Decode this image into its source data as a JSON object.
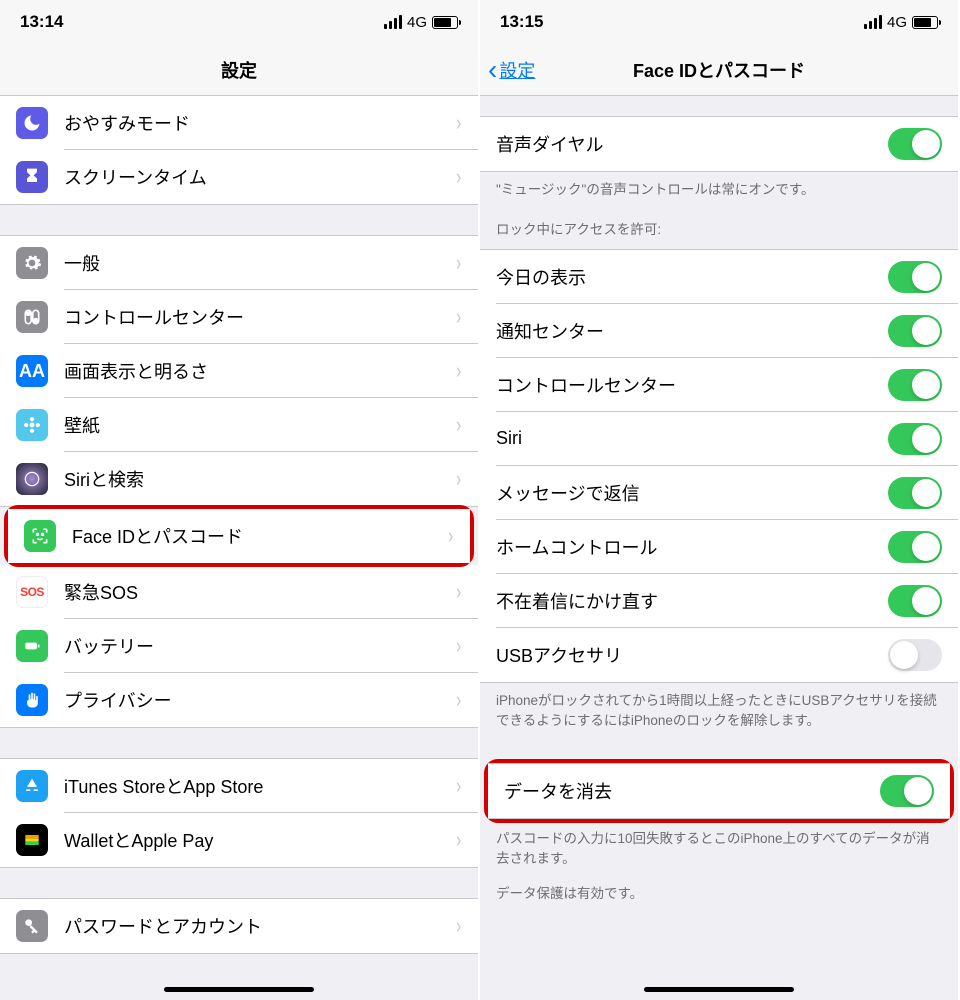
{
  "left": {
    "status": {
      "time": "13:14",
      "net": "4G"
    },
    "nav": {
      "title": "設定"
    },
    "g1": [
      {
        "label": "おやすみモード"
      },
      {
        "label": "スクリーンタイム"
      }
    ],
    "g2": [
      {
        "label": "一般"
      },
      {
        "label": "コントロールセンター"
      },
      {
        "label": "画面表示と明るさ"
      },
      {
        "label": "壁紙"
      },
      {
        "label": "Siriと検索"
      },
      {
        "label": "Face IDとパスコード"
      },
      {
        "label": "緊急SOS"
      },
      {
        "label": "バッテリー"
      },
      {
        "label": "プライバシー"
      }
    ],
    "g3": [
      {
        "label": "iTunes StoreとApp Store"
      },
      {
        "label": "WalletとApple Pay"
      }
    ],
    "g4": [
      {
        "label": "パスワードとアカウント"
      }
    ]
  },
  "right": {
    "status": {
      "time": "13:15",
      "net": "4G"
    },
    "nav": {
      "back": "設定",
      "title": "Face IDとパスコード"
    },
    "voice": {
      "label": "音声ダイヤル",
      "on": true
    },
    "voice_footer": "\"ミュージック\"の音声コントロールは常にオンです。",
    "lock_header": "ロック中にアクセスを許可:",
    "lock_items": [
      {
        "label": "今日の表示",
        "on": true
      },
      {
        "label": "通知センター",
        "on": true
      },
      {
        "label": "コントロールセンター",
        "on": true
      },
      {
        "label": "Siri",
        "on": true
      },
      {
        "label": "メッセージで返信",
        "on": true
      },
      {
        "label": "ホームコントロール",
        "on": true
      },
      {
        "label": "不在着信にかけ直す",
        "on": true
      },
      {
        "label": "USBアクセサリ",
        "on": false
      }
    ],
    "usb_footer": "iPhoneがロックされてから1時間以上経ったときにUSBアクセサリを接続できるようにするにはiPhoneのロックを解除します。",
    "erase": {
      "label": "データを消去",
      "on": true
    },
    "erase_footer": "パスコードの入力に10回失敗するとこのiPhone上のすべてのデータが消去されます。",
    "protect_footer": "データ保護は有効です。"
  }
}
